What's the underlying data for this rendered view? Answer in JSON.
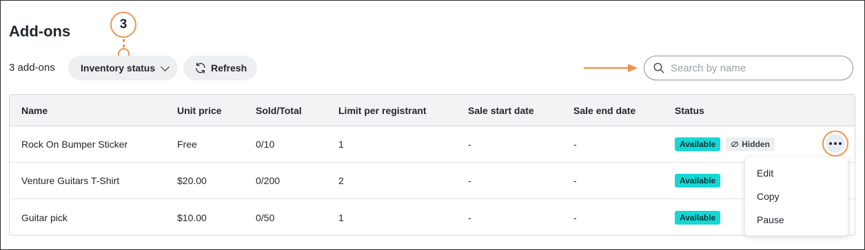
{
  "page": {
    "title": "Add-ons",
    "count_label": "3 add-ons"
  },
  "callout": {
    "number": "3"
  },
  "toolbar": {
    "inventory_label": "Inventory status",
    "refresh_label": "Refresh",
    "search_placeholder": "Search by name"
  },
  "table": {
    "headers": [
      "Name",
      "Unit price",
      "Sold/Total",
      "Limit per registrant",
      "Sale start date",
      "Sale end date",
      "Status"
    ],
    "rows": [
      {
        "name": "Rock On Bumper Sticker",
        "price": "Free",
        "sold": "0/10",
        "limit": "1",
        "start": "-",
        "end": "-",
        "status": "Available",
        "extra": "Hidden"
      },
      {
        "name": "Venture Guitars T-Shirt",
        "price": "$20.00",
        "sold": "0/200",
        "limit": "2",
        "start": "-",
        "end": "-",
        "status": "Available"
      },
      {
        "name": "Guitar pick",
        "price": "$10.00",
        "sold": "0/50",
        "limit": "1",
        "start": "-",
        "end": "-",
        "status": "Available"
      }
    ]
  },
  "menu": {
    "items": [
      "Edit",
      "Copy",
      "Pause"
    ]
  },
  "colors": {
    "accent": "#f0924e",
    "available": "#14d8d6"
  }
}
